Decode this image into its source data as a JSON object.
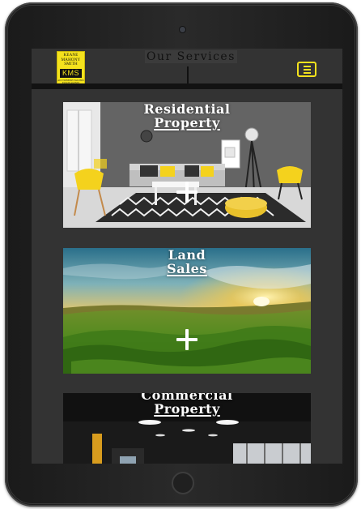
{
  "header": {
    "logo": {
      "name_lines": [
        "KEANE",
        "MAHONY",
        "SMITH"
      ],
      "mark": "KMS",
      "tagline": "AUCTIONEERS VALUERS ESTATE AGENTS"
    },
    "title": "Our Services",
    "menu_icon": "hamburger-icon"
  },
  "services": [
    {
      "title_line1": "Residential",
      "title_line2": "Property",
      "action_icon": "plus-icon"
    },
    {
      "title_line1": "Land",
      "title_line2": "Sales",
      "action_icon": "plus-icon"
    },
    {
      "title_line1": "Commercial",
      "title_line2": "Property"
    }
  ],
  "colors": {
    "brand_yellow": "#f4e21d",
    "screen_background": "#333333",
    "header_bar": "#121212",
    "text_light": "#ffffff"
  }
}
